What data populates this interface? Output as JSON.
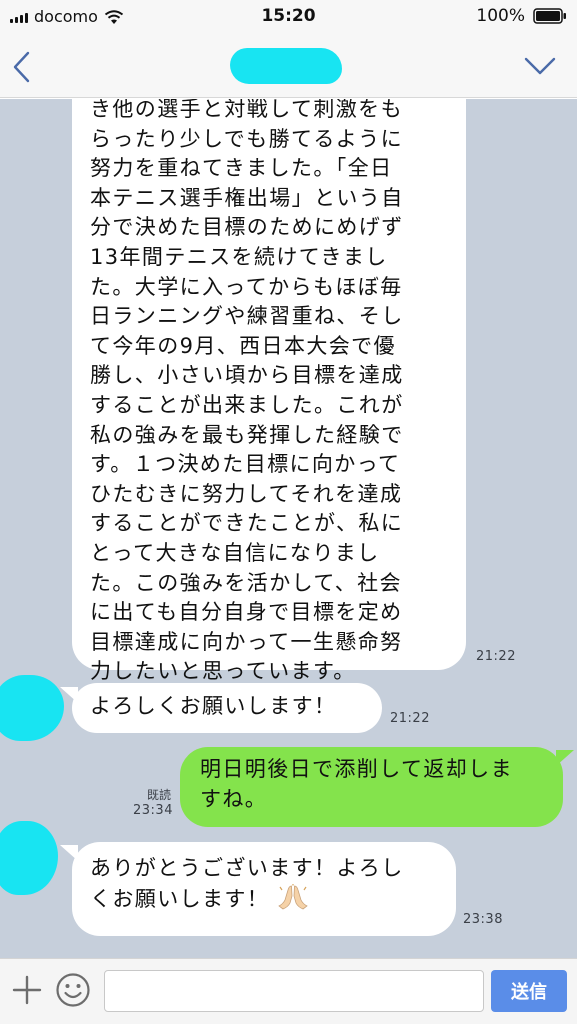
{
  "status_bar": {
    "carrier": "docomo",
    "time": "15:20",
    "battery": "100%"
  },
  "header": {
    "back_icon": "chevron-left-icon",
    "menu_icon": "chevron-down-icon",
    "accent_color": "#4a6aa8"
  },
  "messages": [
    {
      "direction": "incoming",
      "lines": [
        "き他の選手と対戦して刺激をも",
        "らったり少しでも勝てるように",
        "努力を重ねてきました。「全日",
        "本テニス選手権出場」という自",
        "分で決めた目標のためにめげず",
        "13年間テニスを続けてきまし",
        "た。大学に入ってからもほぼ毎",
        "日ランニングや練習重ね、そし",
        "て今年の9月、西日本大会で優",
        "勝し、小さい頃から目標を達成",
        "することが出来ました。これが",
        "私の強みを最も発揮した経験で",
        "す。１つ決めた目標に向かって",
        "ひたむきに努力してそれを達成",
        "することができたことが、私に",
        "とって大きな自信になりまし",
        "た。この強みを活かして、社会",
        "に出ても自分自身で目標を定め",
        "目標達成に向かって一生懸命努",
        "力したいと思っています。"
      ],
      "time": "21:22"
    },
    {
      "direction": "incoming",
      "text": "よろしくお願いします！",
      "time": "21:22"
    },
    {
      "direction": "outgoing",
      "lines": [
        "明日明後日で添削して返却しま",
        "すね。"
      ],
      "read_label": "既読",
      "time": "23:34"
    },
    {
      "direction": "incoming",
      "lines": [
        "ありがとうございます！よろし",
        "くお願いします！"
      ],
      "emoji": "folded-hands-icon",
      "time": "23:38"
    }
  ],
  "input_bar": {
    "placeholder": "",
    "send_label": "送信",
    "plus_icon": "plus-icon",
    "smiley_icon": "smiley-icon"
  },
  "colors": {
    "chat_background": "#c6cfdb",
    "incoming_bubble": "#ffffff",
    "outgoing_bubble": "#84e34c",
    "redaction": "#18e4f2",
    "send_button": "#5a8de8"
  }
}
